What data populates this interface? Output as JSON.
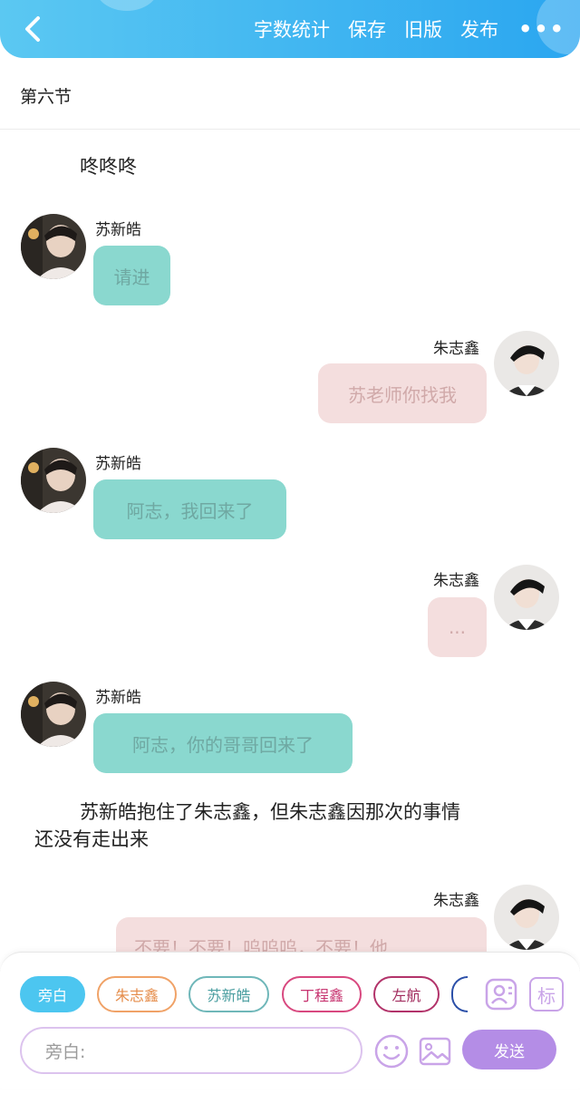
{
  "header": {
    "links": [
      "字数统计",
      "保存",
      "旧版",
      "发布"
    ],
    "more": "•••"
  },
  "section_title": "第六节",
  "messages": [
    {
      "type": "narration",
      "text": "咚咚咚"
    },
    {
      "type": "left",
      "speaker": "苏新皓",
      "text": "请进"
    },
    {
      "type": "right",
      "speaker": "朱志鑫",
      "text": "苏老师你找我"
    },
    {
      "type": "left",
      "speaker": "苏新皓",
      "text": "阿志，我回来了"
    },
    {
      "type": "right",
      "speaker": "朱志鑫",
      "text": "..."
    },
    {
      "type": "left",
      "speaker": "苏新皓",
      "text": "阿志，你的哥哥回来了"
    },
    {
      "type": "narration",
      "text": "苏新皓抱住了朱志鑫，但朱志鑫因那次的事情"
    },
    {
      "type": "narration",
      "text": "还没有走出来"
    },
    {
      "type": "right",
      "speaker": "朱志鑫",
      "text": "不要！不要！呜呜呜，不要！他"
    }
  ],
  "roles": [
    {
      "label": "旁白",
      "color": "#4cc6f0",
      "active": true
    },
    {
      "label": "朱志鑫",
      "color": "#f0a267",
      "active": false
    },
    {
      "label": "苏新皓",
      "color": "#6fb7b9",
      "active": false
    },
    {
      "label": "丁程鑫",
      "color": "#d8487f",
      "active": false
    },
    {
      "label": "左航",
      "color": "#b2336a",
      "active": false
    }
  ],
  "input": {
    "placeholder": "旁白:"
  },
  "send_label": "发送",
  "tag_icon_label": "标",
  "colors": {
    "header": "#2aa6f0",
    "left_bubble": "#8ad8cf",
    "right_bubble": "#f4dede",
    "send": "#b48de6"
  }
}
